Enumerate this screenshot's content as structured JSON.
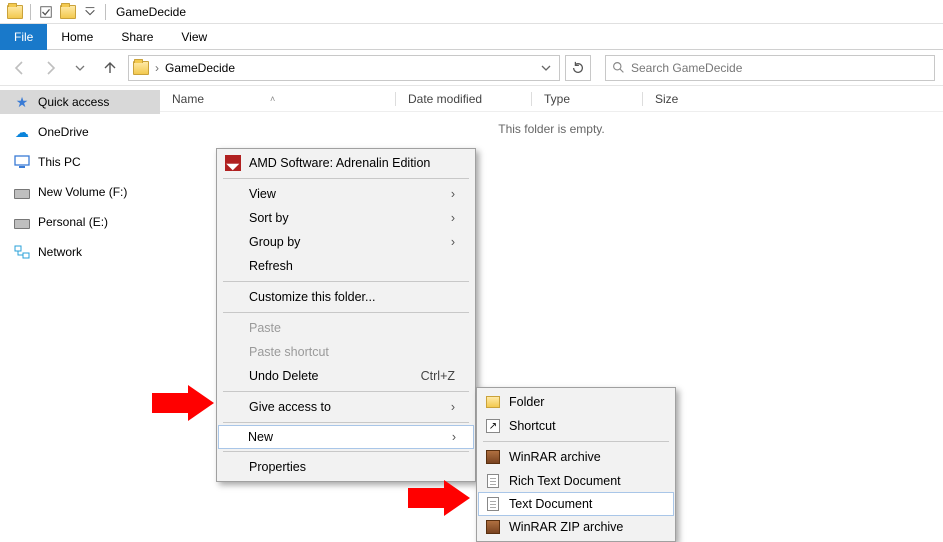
{
  "titlebar": {
    "title": "GameDecide"
  },
  "ribbon": {
    "file": "File",
    "home": "Home",
    "share": "Share",
    "view": "View"
  },
  "nav": {
    "crumb": "GameDecide",
    "search_placeholder": "Search GameDecide"
  },
  "sidebar": {
    "quick": "Quick access",
    "onedrive": "OneDrive",
    "thispc": "This PC",
    "volF": "New Volume (F:)",
    "volE": "Personal (E:)",
    "network": "Network"
  },
  "columns": {
    "name": "Name",
    "date": "Date modified",
    "type": "Type",
    "size": "Size"
  },
  "empty": "This folder is empty.",
  "context": {
    "amd": "AMD Software: Adrenalin Edition",
    "view": "View",
    "sortby": "Sort by",
    "groupby": "Group by",
    "refresh": "Refresh",
    "customize": "Customize this folder...",
    "paste": "Paste",
    "pasteShortcut": "Paste shortcut",
    "undo": "Undo Delete",
    "undo_sc": "Ctrl+Z",
    "giveAccess": "Give access to",
    "new": "New",
    "properties": "Properties"
  },
  "submenu": {
    "folder": "Folder",
    "shortcut": "Shortcut",
    "winrar": "WinRAR archive",
    "rtf": "Rich Text Document",
    "txt": "Text Document",
    "zip": "WinRAR ZIP archive"
  }
}
